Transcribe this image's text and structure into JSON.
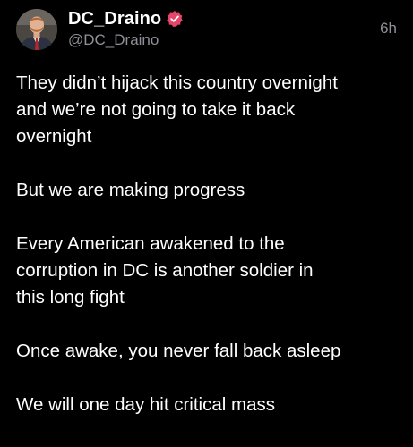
{
  "post": {
    "display_name": "DC_Draino",
    "handle": "@DC_Draino",
    "timestamp": "6h",
    "verified_icon": "verified-badge-icon",
    "avatar_icon": "profile-photo",
    "colors": {
      "background": "#000000",
      "text": "#ffffff",
      "muted": "#8f8f97",
      "verified": "#e8456b"
    },
    "paragraphs": [
      "They didn’t hijack this country overnight\nand we’re not going to take it back\novernight",
      "But we are making progress",
      "Every American awakened to the\ncorruption in DC is another soldier in\nthis long fight",
      "Once awake, you never fall back asleep",
      "We will one day hit critical mass"
    ]
  }
}
